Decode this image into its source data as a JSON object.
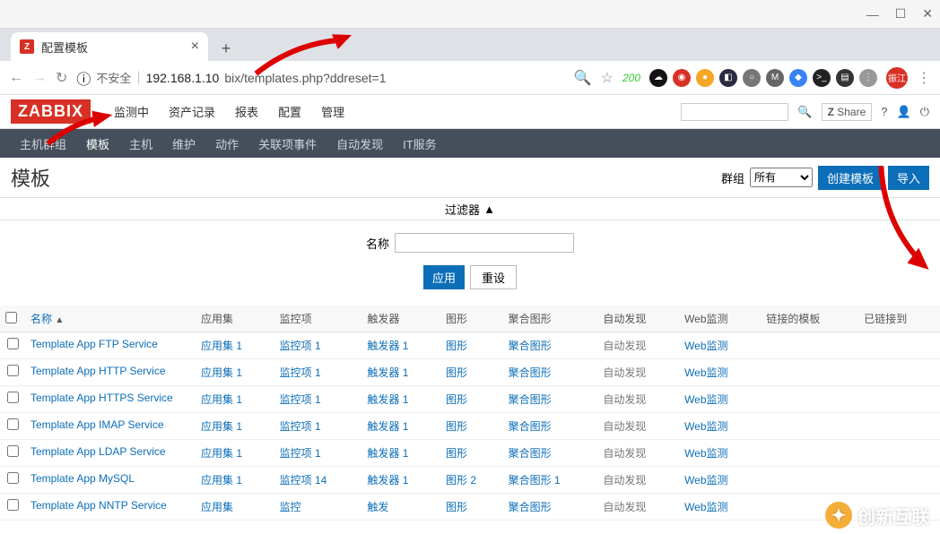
{
  "window": {
    "minimize": "—",
    "maximize": "☐",
    "close": "✕"
  },
  "tab": {
    "fav": "Z",
    "title": "配置模板",
    "close": "×",
    "new": "+"
  },
  "url": {
    "back": "←",
    "fwd": "→",
    "reload": "↻",
    "insecure_icon": "ⓘ",
    "insecure": "不安全",
    "host": "192.168.1.10",
    "path": "bix/templates.php?ddreset=1",
    "search_icon": "🔍",
    "star": "☆"
  },
  "exts": {
    "num": "200",
    "list": [
      {
        "bg": "#131316",
        "t": "☁"
      },
      {
        "bg": "#d93025",
        "t": "◉"
      },
      {
        "bg": "#f5a623",
        "t": "●"
      },
      {
        "bg": "#2a2a40",
        "t": "◧"
      },
      {
        "bg": "#777",
        "t": "○"
      },
      {
        "bg": "#666",
        "t": "M"
      },
      {
        "bg": "#3b82f6",
        "t": "◆"
      },
      {
        "bg": "#222",
        "t": ">_"
      },
      {
        "bg": "#333",
        "t": "▤"
      },
      {
        "bg": "#999",
        "t": "⋮"
      }
    ],
    "avatar": "振江",
    "menu": "⋮"
  },
  "zbx": {
    "logo": "ZABBIX",
    "top": [
      "监测中",
      "资产记录",
      "报表",
      "配置",
      "管理"
    ],
    "search_icon": "🔍",
    "share_icon": "Z",
    "share": "Share",
    "help": "?",
    "user": "👤",
    "logout": "⏻",
    "sub": [
      "主机群组",
      "模板",
      "主机",
      "维护",
      "动作",
      "关联项事件",
      "自动发现",
      "IT服务"
    ],
    "sub_active": 1
  },
  "page": {
    "title": "模板",
    "group_label": "群组",
    "group_value": "所有",
    "create": "创建模板",
    "import": "导入"
  },
  "filter": {
    "toggle": "过滤器",
    "arrow": "▲",
    "name_label": "名称",
    "name_value": "",
    "apply": "应用",
    "reset": "重设"
  },
  "columns": {
    "chk": "",
    "name": "名称",
    "sort": "▲",
    "apps": "应用集",
    "items": "监控项",
    "triggers": "触发器",
    "graphs": "图形",
    "agg": "聚合图形",
    "disc": "自动发现",
    "web": "Web监测",
    "linked": "链接的模板",
    "linkedto": "已链接到"
  },
  "rows": [
    {
      "name": "Template App FTP Service",
      "apps": "应用集 1",
      "items": "监控项 1",
      "trg": "触发器 1",
      "gr": "图形",
      "agg": "聚合图形",
      "disc": "自动发现",
      "web": "Web监测"
    },
    {
      "name": "Template App HTTP Service",
      "apps": "应用集 1",
      "items": "监控项 1",
      "trg": "触发器 1",
      "gr": "图形",
      "agg": "聚合图形",
      "disc": "自动发现",
      "web": "Web监测"
    },
    {
      "name": "Template App HTTPS Service",
      "apps": "应用集 1",
      "items": "监控项 1",
      "trg": "触发器 1",
      "gr": "图形",
      "agg": "聚合图形",
      "disc": "自动发现",
      "web": "Web监测"
    },
    {
      "name": "Template App IMAP Service",
      "apps": "应用集 1",
      "items": "监控项 1",
      "trg": "触发器 1",
      "gr": "图形",
      "agg": "聚合图形",
      "disc": "自动发现",
      "web": "Web监测"
    },
    {
      "name": "Template App LDAP Service",
      "apps": "应用集 1",
      "items": "监控项 1",
      "trg": "触发器 1",
      "gr": "图形",
      "agg": "聚合图形",
      "disc": "自动发现",
      "web": "Web监测"
    },
    {
      "name": "Template App MySQL",
      "apps": "应用集 1",
      "items": "监控项 14",
      "trg": "触发器 1",
      "gr": "图形 2",
      "agg": "聚合图形 1",
      "disc": "自动发现",
      "web": "Web监测"
    },
    {
      "name": "Template App NNTP Service",
      "apps": "应用集",
      "items": "监控",
      "trg": "触发",
      "gr": "图形",
      "agg": "聚合图形",
      "disc": "自动发现",
      "web": "Web监测"
    }
  ],
  "watermark": "创新互联"
}
